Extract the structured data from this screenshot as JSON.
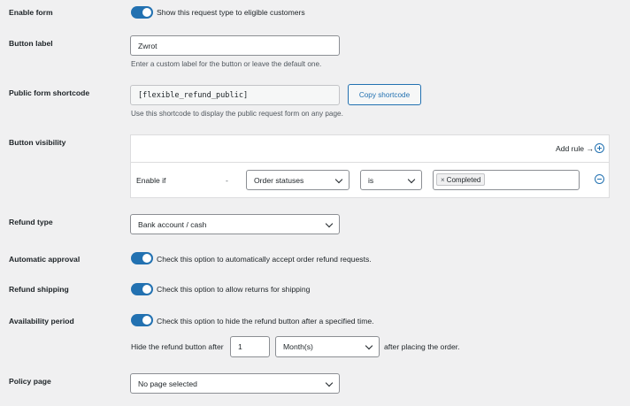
{
  "enable_form": {
    "label": "Enable form",
    "toggle_text": "Show this request type to eligible customers"
  },
  "button_label": {
    "label": "Button label",
    "value": "Zwrot",
    "description": "Enter a custom label for the button or leave the default one."
  },
  "shortcode": {
    "label": "Public form shortcode",
    "value": "[flexible_refund_public]",
    "copy_button": "Copy shortcode",
    "description": "Use this shortcode to display the public request form on any page."
  },
  "visibility": {
    "label": "Button visibility",
    "add_rule": "Add rule →",
    "rule": {
      "condition": "Enable if",
      "separator": "-",
      "field": "Order statuses",
      "operator": "is",
      "tag": "Completed",
      "tag_remove": "×"
    }
  },
  "refund_type": {
    "label": "Refund type",
    "value": "Bank account / cash"
  },
  "automatic_approval": {
    "label": "Automatic approval",
    "toggle_text": "Check this option to automatically accept order refund requests."
  },
  "refund_shipping": {
    "label": "Refund shipping",
    "toggle_text": "Check this option to allow returns for shipping"
  },
  "availability": {
    "label": "Availability period",
    "toggle_text": "Check this option to hide the refund button after a specified time.",
    "hide_prefix": "Hide the refund button after",
    "amount": "1",
    "unit": "Month(s)",
    "suffix": "after placing the order."
  },
  "policy_page": {
    "label": "Policy page",
    "value": "No page selected"
  },
  "colors": {
    "accent": "#2271b1",
    "background": "#f0f0f1"
  }
}
